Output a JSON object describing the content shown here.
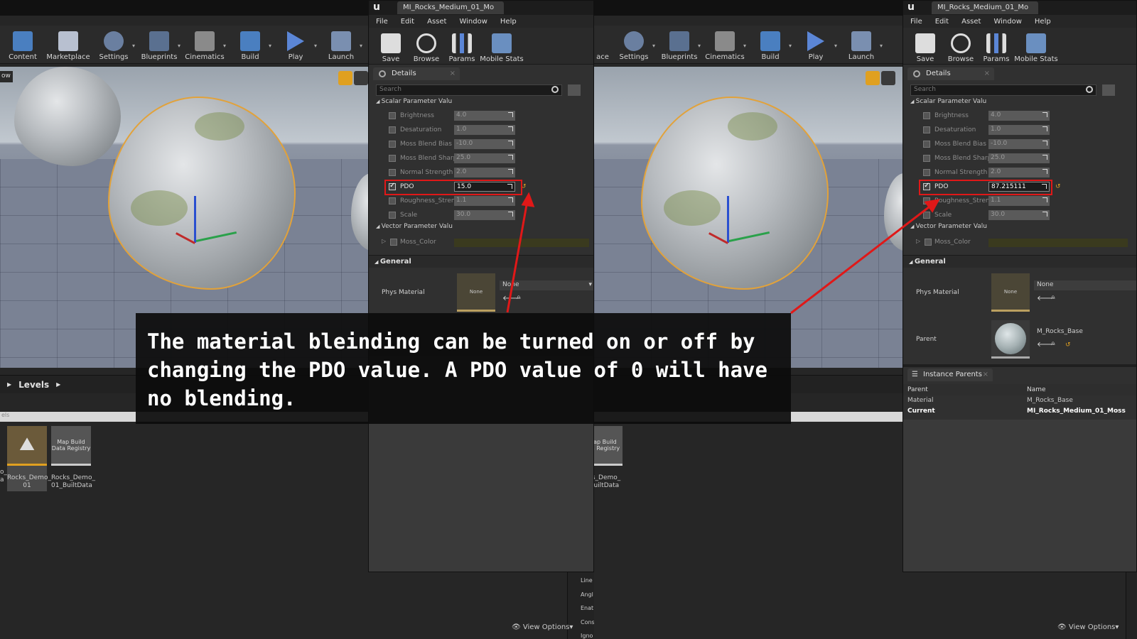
{
  "toolbar": {
    "left": [
      "Content",
      "Marketplace",
      "Settings",
      "Blueprints",
      "Cinematics",
      "Build",
      "Play",
      "Launch"
    ],
    "right": [
      "ace",
      "Settings",
      "Blueprints",
      "Cinematics",
      "Build",
      "Play",
      "Launch"
    ]
  },
  "viewport_left_label": "ow",
  "levels": {
    "label": "Levels",
    "search_text": "els"
  },
  "assets_left": [
    {
      "thumb": "",
      "label": "Rocks_Demo_\n01"
    },
    {
      "thumb": "Map Build\nData Registry",
      "label": "Rocks_Demo_\n01_BuiltData"
    }
  ],
  "assets_left_partial": "o_\na",
  "assets_right": [
    {
      "thumb": "Map Build\nata Registry",
      "label": "cks_Demo_\n_BuiltData"
    }
  ],
  "mi_window": {
    "tab_title": "MI_Rocks_Medium_01_Mo",
    "menu": [
      "File",
      "Edit",
      "Asset",
      "Window",
      "Help"
    ],
    "tools": [
      "Save",
      "Browse",
      "Params",
      "Mobile Stats"
    ],
    "details_tab": "Details",
    "search_placeholder": "Search",
    "scalar_section": "Scalar Parameter Valu",
    "vector_section": "Vector Parameter Valu",
    "moss_color": "Moss_Color",
    "general": "General",
    "phys_material_label": "Phys Material",
    "none_thumb": "None",
    "none_combo": "None",
    "parent_label": "Parent",
    "parent_value": "M_Rocks_Base",
    "instance_parents_tab": "Instance Parents",
    "ip_col_parent": "Parent",
    "ip_col_name": "Name",
    "ip_rows": [
      {
        "parent": "Material",
        "name": "M_Rocks_Base"
      },
      {
        "parent": "Current",
        "name": "MI_Rocks_Medium_01_Moss"
      }
    ]
  },
  "params_left": [
    {
      "label": "Brightness",
      "value": "4.0",
      "checked": false
    },
    {
      "label": "Desaturation",
      "value": "1.0",
      "checked": false
    },
    {
      "label": "Moss Blend Bias (",
      "value": "-10.0",
      "checked": false
    },
    {
      "label": "Moss Blend Sharp",
      "value": "25.0",
      "checked": false
    },
    {
      "label": "Normal Strength",
      "value": "2.0",
      "checked": false
    },
    {
      "label": "PDO",
      "value": "15.0",
      "checked": true
    },
    {
      "label": "Roughness_Streng",
      "value": "1.1",
      "checked": false
    },
    {
      "label": "Scale",
      "value": "30.0",
      "checked": false
    }
  ],
  "params_right": [
    {
      "label": "Brightness",
      "value": "4.0",
      "checked": false
    },
    {
      "label": "Desaturation",
      "value": "1.0",
      "checked": false
    },
    {
      "label": "Moss Blend Bias (",
      "value": "-10.0",
      "checked": false
    },
    {
      "label": "Moss Blend Sharp",
      "value": "25.0",
      "checked": false
    },
    {
      "label": "Normal Strength",
      "value": "2.0",
      "checked": false
    },
    {
      "label": "PDO",
      "value": "87.215111",
      "checked": true
    },
    {
      "label": "Roughness_Streng",
      "value": "1.1",
      "checked": false
    },
    {
      "label": "Scale",
      "value": "30.0",
      "checked": false
    }
  ],
  "side_panel": [
    "Line",
    "Angl",
    "Enat",
    "Cons",
    "Igno"
  ],
  "view_options": "View Options",
  "caption": "The material bleinding can be turned on or off by changing the PDO value. A PDO value of 0 will have no blending.",
  "colors": {
    "highlight_red": "#e01818",
    "selection_orange": "#e2a23a",
    "caption_bg": "#0c0c0c"
  }
}
